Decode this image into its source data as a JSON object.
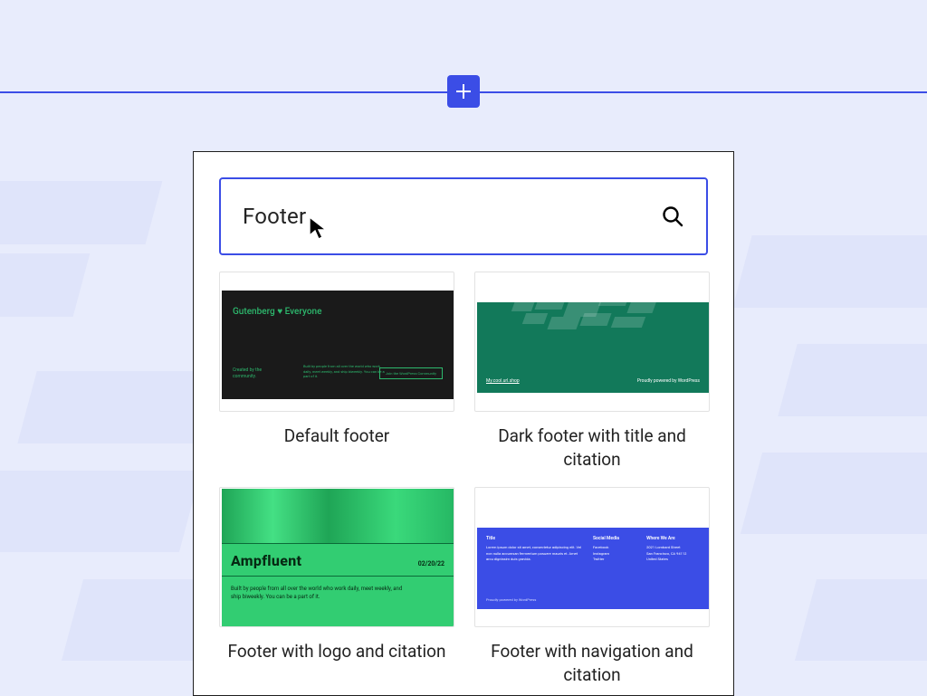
{
  "search": {
    "value": "Footer"
  },
  "cards": [
    {
      "label": "Default footer"
    },
    {
      "label": "Dark footer with title and citation"
    },
    {
      "label": "Footer with logo and citation"
    },
    {
      "label": "Footer with navigation and citation"
    }
  ],
  "thumb1": {
    "title": "Gutenberg ♥ Everyone",
    "created_by": "Created by the community.",
    "desc": "Built by people from all over the world who work daily, meet weekly, and ship biweekly. You can be a part of it.",
    "button": "Join the WordPress Community"
  },
  "thumb2": {
    "left": "My.cool.url.shop",
    "right": "Proudly powered by WordPress"
  },
  "thumb3": {
    "brand": "Ampfluent",
    "date": "02/20/22",
    "desc": "Built by people from all over the world who work daily, meet weekly, and ship biweekly. You can be a part of it."
  },
  "thumb4": {
    "col1_h": "Title",
    "col1_body": "Lorem ipsum dolor sit amet, consectetur adipiscing elit. Vel non nulla accumsan fermentum posuere mauris et. Amet arcu dignissim duis gravida.",
    "col2_h": "Social Media",
    "col2_items": "Facebook\nInstagram\nTwitter",
    "col3_h": "Where We Are",
    "col3_items": "2021 Lombard Street\nSan Francisco, CA 94112\nUnited States",
    "bottom": "Proudly powered by WordPress"
  },
  "colors": {
    "accent": "#3b4de6",
    "bg": "#e8ecfc"
  }
}
